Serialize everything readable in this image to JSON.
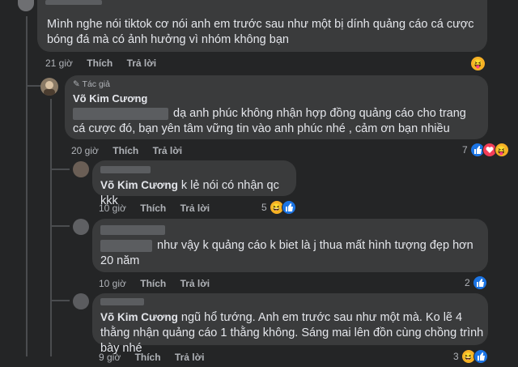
{
  "comments": [
    {
      "text": "Mình nghe nói tiktok cơ nói anh em trước sau như một bị dính quảng cáo cá cược bóng đá mà có ảnh hưởng vì nhóm không bạn",
      "time": "21 giờ",
      "like": "Thích",
      "reply": "Trả lời"
    },
    {
      "badge": "Tác giả",
      "author": "Võ Kim Cương",
      "text": "dạ anh phúc không nhận hợp đồng quảng cáo cho trang cá cược đó, bạn yên tâm vững tin vào anh phúc nhé , cảm ơn bạn nhiều",
      "time": "20 giờ",
      "like": "Thích",
      "reply": "Trả lời",
      "reaction_count": "7"
    },
    {
      "mention": "Võ Kim Cương",
      "text": "k lẻ nói có nhận qc kkk",
      "time": "10 giờ",
      "like": "Thích",
      "reply": "Trả lời",
      "reaction_count": "5"
    },
    {
      "text": "như vậy k quảng cáo k biet là j thua mất hình tượng đẹp hơn 20 năm",
      "time": "10 giờ",
      "like": "Thích",
      "reply": "Trả lời",
      "reaction_count": "2"
    },
    {
      "mention": "Võ Kim Cương",
      "text": "ngũ hổ tướng. Anh em trước sau như một mà. Ko lẽ 4 thằng nhận quảng cáo 1 thằng không. Sáng mai lên đồn cùng chồng trình bày nhé",
      "time": "9 giờ",
      "like": "Thích",
      "reply": "Trả lời",
      "reaction_count": "3"
    }
  ],
  "colors": {
    "background": "#242526",
    "bubble": "#3a3b3c",
    "like": "#1b74e4",
    "heart": "#f33e58",
    "haha": "#f7b125"
  }
}
